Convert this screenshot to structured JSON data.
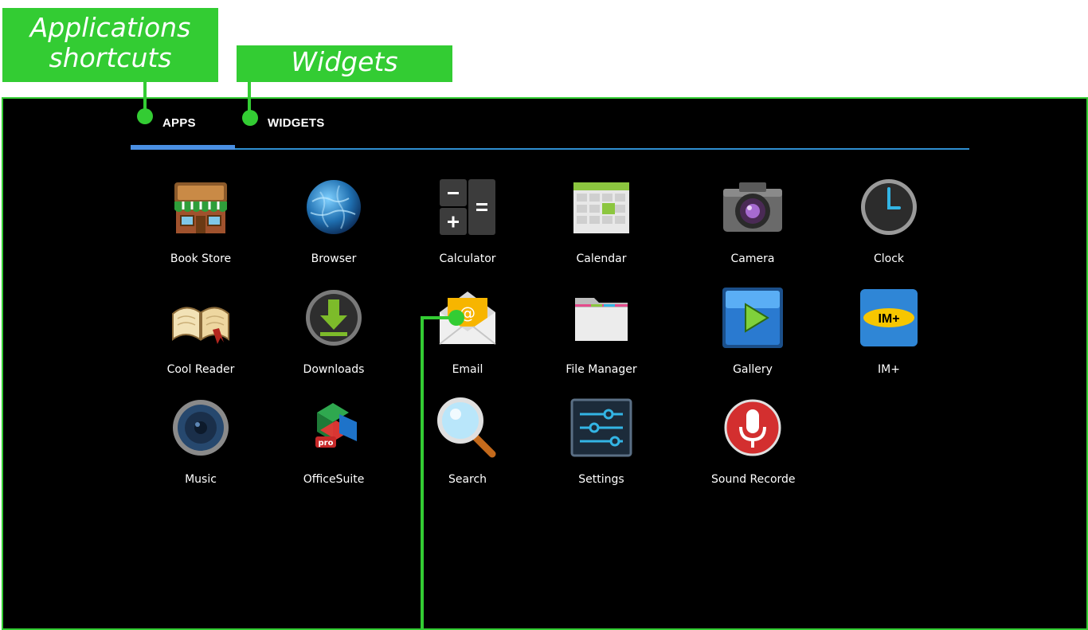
{
  "callouts": {
    "apps_line1": "Applications",
    "apps_line2": "shortcuts",
    "widgets": "Widgets"
  },
  "tabs": [
    {
      "label": "APPS",
      "active": true
    },
    {
      "label": "WIDGETS",
      "active": false
    }
  ],
  "apps": [
    {
      "label": "Book Store",
      "icon": "book-store-icon"
    },
    {
      "label": "Browser",
      "icon": "globe-icon"
    },
    {
      "label": "Calculator",
      "icon": "calculator-icon"
    },
    {
      "label": "Calendar",
      "icon": "calendar-icon"
    },
    {
      "label": "Camera",
      "icon": "camera-icon"
    },
    {
      "label": "Clock",
      "icon": "clock-icon"
    },
    {
      "label": "Cool Reader",
      "icon": "open-book-icon"
    },
    {
      "label": "Downloads",
      "icon": "download-icon"
    },
    {
      "label": "Email",
      "icon": "envelope-icon"
    },
    {
      "label": "File Manager",
      "icon": "folder-icon"
    },
    {
      "label": "Gallery",
      "icon": "gallery-play-icon"
    },
    {
      "label": "IM+",
      "icon": "im-plus-icon"
    },
    {
      "label": "Music",
      "icon": "speaker-icon"
    },
    {
      "label": "OfficeSuite",
      "icon": "office-suite-icon",
      "badge": "pro"
    },
    {
      "label": "Search",
      "icon": "magnifier-icon"
    },
    {
      "label": "Settings",
      "icon": "settings-sliders-icon"
    },
    {
      "label": "Sound Recorde",
      "icon": "microphone-icon"
    }
  ],
  "colors": {
    "callout_green": "#33cc33",
    "tab_accent": "#4a8fe2",
    "screen_bg": "#000000"
  }
}
